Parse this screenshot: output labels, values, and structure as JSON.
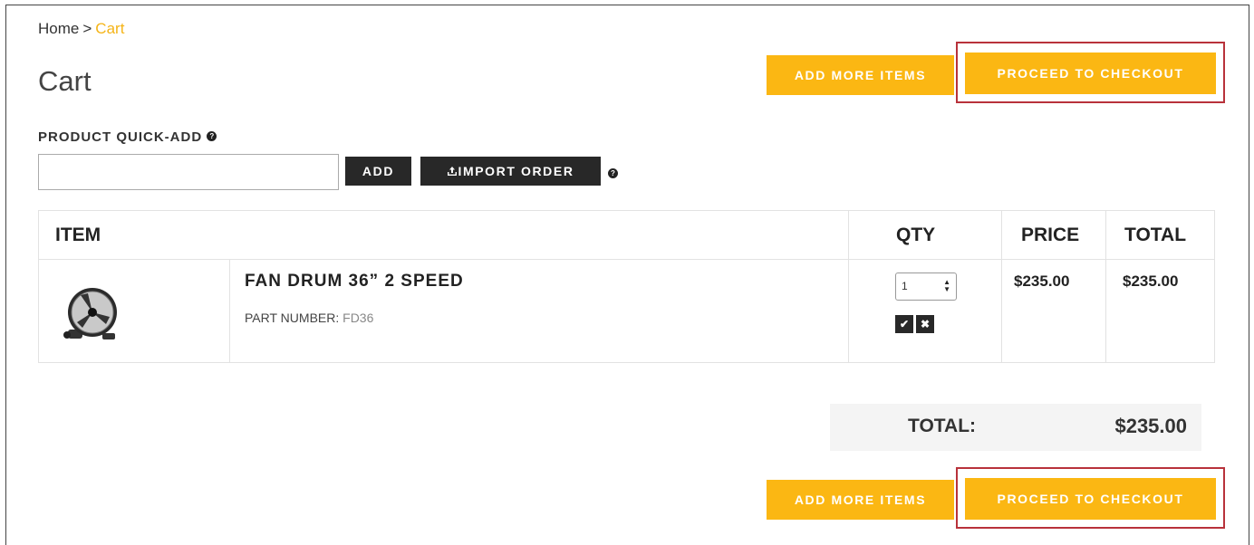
{
  "breadcrumb": {
    "home": "Home",
    "separator": ">",
    "current": "Cart"
  },
  "page": {
    "title": "Cart"
  },
  "buttons": {
    "add_more_items": "ADD MORE ITEMS",
    "proceed_to_checkout": "PROCEED TO CHECKOUT"
  },
  "quick_add": {
    "label": "PRODUCT QUICK-ADD",
    "help_icon": "question-circle-icon",
    "input_value": "",
    "add_label": "ADD",
    "import_icon": "upload-icon",
    "import_label": "IMPORT ORDER"
  },
  "table": {
    "headers": {
      "item": "ITEM",
      "qty": "QTY",
      "price": "PRICE",
      "total": "TOTAL"
    },
    "rows": [
      {
        "image_icon": "drum-fan-image",
        "name": "FAN DRUM 36” 2 SPEED",
        "part_number_label": "PART NUMBER:",
        "part_number": "FD36",
        "qty": "1",
        "price": "$235.00",
        "total": "$235.00"
      }
    ]
  },
  "summary": {
    "label": "TOTAL:",
    "value": "$235.00"
  },
  "colors": {
    "accent": "#fbb713",
    "dark_button": "#282828",
    "highlight": "#b8323b",
    "breadcrumb_current": "#f5b417"
  }
}
